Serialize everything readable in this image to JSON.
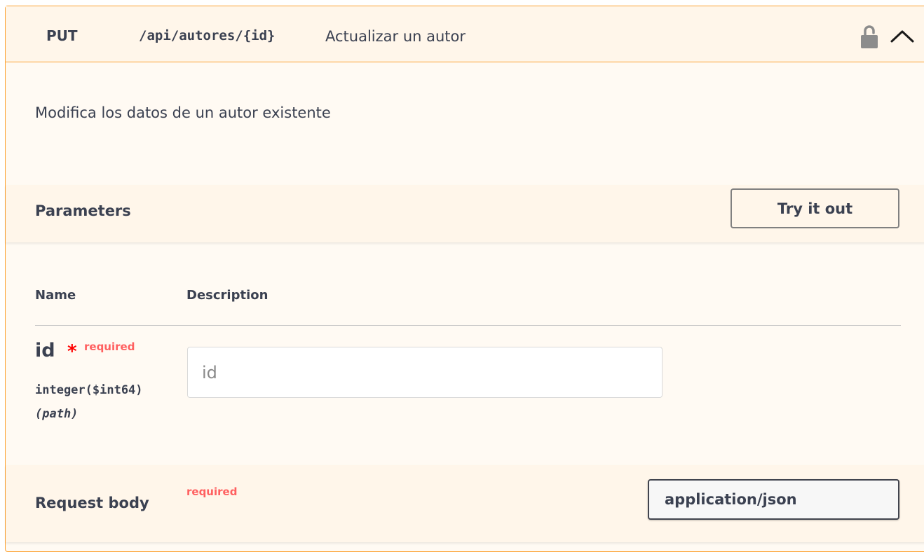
{
  "operation": {
    "method": "PUT",
    "path": "/api/autores/{id}",
    "summary": "Actualizar un autor",
    "description": "Modifica los datos de un autor existente",
    "colors": {
      "accent": "#fca130",
      "background": "#fff6ea",
      "required": "#ff0000"
    },
    "icons": {
      "lock": "unlocked-lock-icon",
      "collapse": "chevron-up-icon"
    }
  },
  "parameters": {
    "title": "Parameters",
    "try_button": "Try it out",
    "columns": {
      "name": "Name",
      "description": "Description"
    },
    "items": [
      {
        "name": "id",
        "required_mark": "*",
        "required_label": "required",
        "type": "integer($int64)",
        "in": "(path)",
        "placeholder": "id",
        "value": ""
      }
    ]
  },
  "request_body": {
    "title": "Request body",
    "required_label": "required",
    "content_type": "application/json"
  }
}
